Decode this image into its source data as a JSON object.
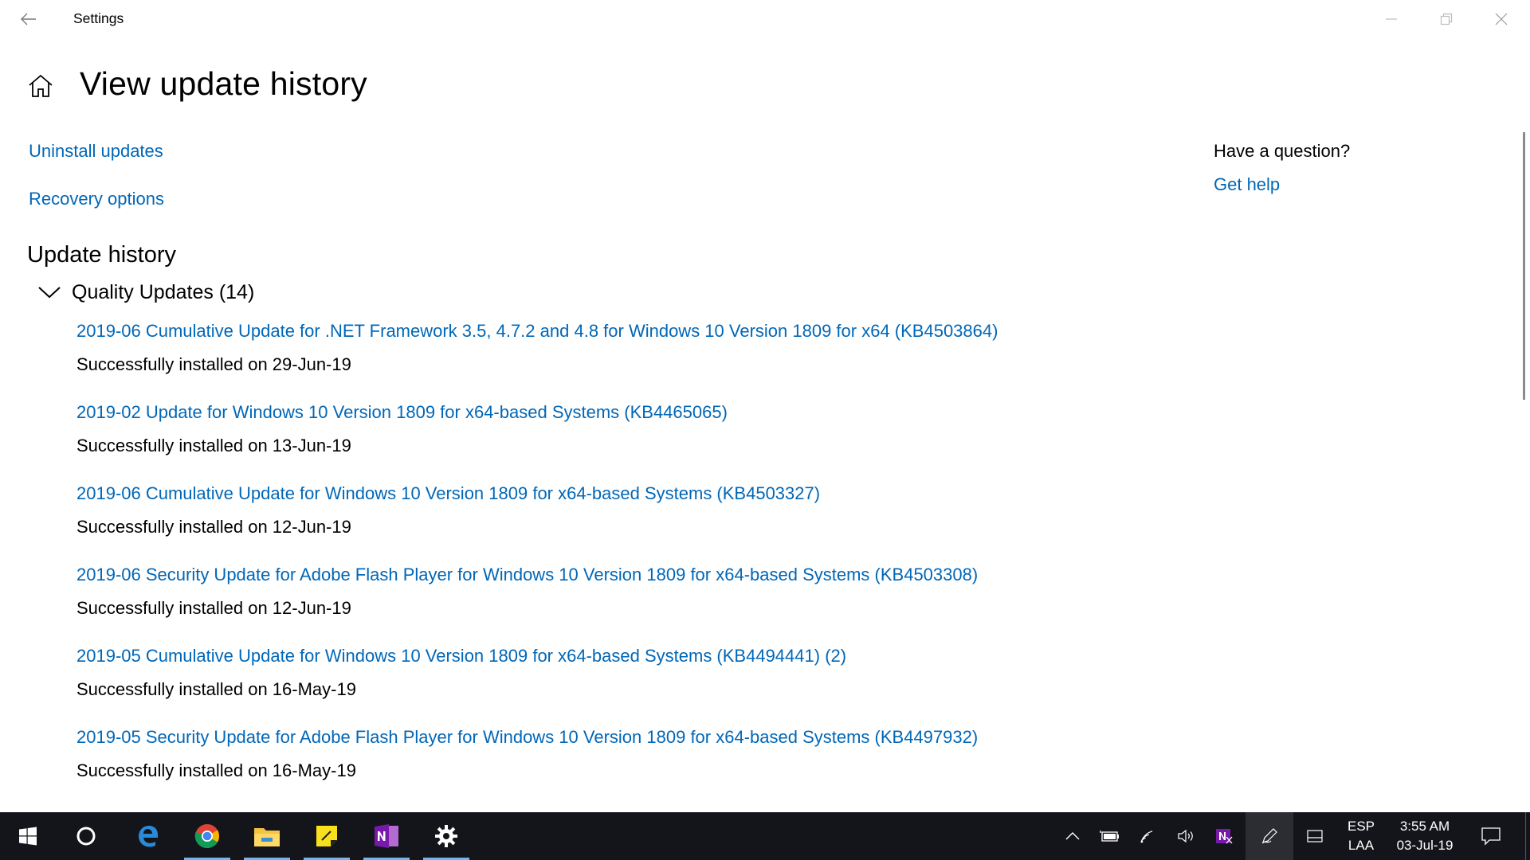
{
  "window": {
    "title": "Settings",
    "back_icon": "back-arrow-icon",
    "minimize_icon": "minimize-icon",
    "restore_icon": "restore-icon",
    "close_icon": "close-icon"
  },
  "header": {
    "home_icon": "home-icon",
    "title": "View update history"
  },
  "links": {
    "uninstall": "Uninstall updates",
    "recovery": "Recovery options"
  },
  "history": {
    "section_title": "Update history",
    "group": {
      "label": "Quality Updates (14)",
      "expanded": true,
      "items": [
        {
          "name": "2019-06 Cumulative Update for .NET Framework 3.5, 4.7.2 and 4.8 for Windows 10 Version 1809 for x64 (KB4503864)",
          "status": "Successfully installed on 29-Jun-19"
        },
        {
          "name": "2019-02 Update for Windows 10 Version 1809 for x64-based Systems (KB4465065)",
          "status": "Successfully installed on 13-Jun-19"
        },
        {
          "name": "2019-06 Cumulative Update for Windows 10 Version 1809 for x64-based Systems (KB4503327)",
          "status": "Successfully installed on 12-Jun-19"
        },
        {
          "name": "2019-06 Security Update for Adobe Flash Player for Windows 10 Version 1809 for x64-based Systems (KB4503308)",
          "status": "Successfully installed on 12-Jun-19"
        },
        {
          "name": "2019-05 Cumulative Update for Windows 10 Version 1809 for x64-based Systems (KB4494441) (2)",
          "status": "Successfully installed on 16-May-19"
        },
        {
          "name": "2019-05 Security Update for Adobe Flash Player for Windows 10 Version 1809 for x64-based Systems (KB4497932)",
          "status": "Successfully installed on 16-May-19"
        }
      ]
    }
  },
  "help": {
    "question": "Have a question?",
    "link": "Get help"
  },
  "taskbar": {
    "apps": [
      "start-icon",
      "cortana-icon",
      "edge-icon",
      "chrome-icon",
      "file-explorer-icon",
      "sticky-notes-icon",
      "onenote-icon",
      "settings-gear-icon"
    ],
    "tray": {
      "language_line1": "ESP",
      "language_line2": "LAA",
      "time": "3:55 AM",
      "date": "03-Jul-19"
    }
  },
  "colors": {
    "link": "#0067b8",
    "taskbar": "#14151a",
    "text": "#000000"
  }
}
